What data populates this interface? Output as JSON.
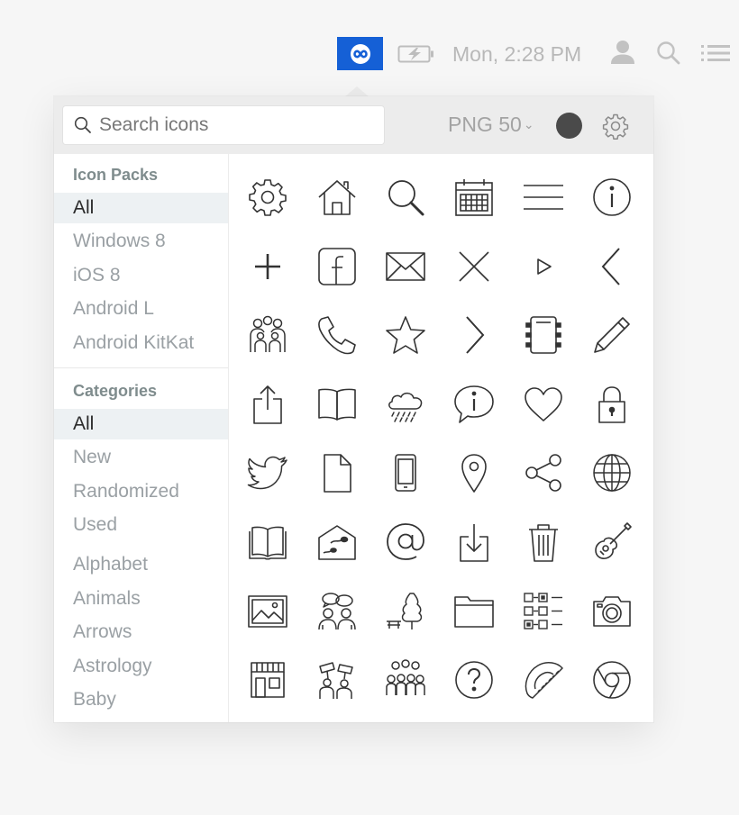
{
  "menubar": {
    "time": "Mon, 2:28 PM",
    "app_color": "#1560d6",
    "icons": [
      "infinity-icon",
      "battery-charging-icon",
      "user-icon",
      "search-icon",
      "list-icon"
    ]
  },
  "toolbar": {
    "search_placeholder": "Search icons",
    "format_label": "PNG 50",
    "color_value": "#4a4a4a"
  },
  "sidebar": {
    "packs_heading": "Icon Packs",
    "packs": [
      {
        "label": "All",
        "active": true
      },
      {
        "label": "Windows 8"
      },
      {
        "label": "iOS 8"
      },
      {
        "label": "Android L"
      },
      {
        "label": "Android KitKat"
      }
    ],
    "categories_heading": "Categories",
    "categories": [
      {
        "label": "All",
        "active": true
      },
      {
        "label": "New"
      },
      {
        "label": "Randomized"
      },
      {
        "label": "Used"
      },
      {
        "label": "Alphabet"
      },
      {
        "label": "Animals"
      },
      {
        "label": "Arrows"
      },
      {
        "label": "Astrology"
      },
      {
        "label": "Baby"
      }
    ]
  },
  "grid": {
    "icons": [
      "gear-icon",
      "home-icon",
      "search-icon",
      "calendar-icon",
      "menu-lines-icon",
      "info-circle-icon",
      "plus-icon",
      "facebook-icon",
      "mail-icon",
      "close-x-icon",
      "play-triangle-icon",
      "chevron-left-icon",
      "group-icon",
      "phone-icon",
      "star-icon",
      "chevron-right-icon",
      "processor-chip-icon",
      "pencil-icon",
      "share-upload-icon",
      "open-book-icon",
      "rain-cloud-icon",
      "info-bubble-icon",
      "heart-icon",
      "lock-icon",
      "twitter-bird-icon",
      "document-icon",
      "smartphone-icon",
      "map-pin-icon",
      "share-nodes-icon",
      "globe-icon",
      "book-icon",
      "sperm-house-icon",
      "at-sign-icon",
      "download-tray-icon",
      "trash-icon",
      "guitar-icon",
      "picture-icon",
      "discussion-icon",
      "park-tree-icon",
      "folder-icon",
      "checklist-icon",
      "camera-icon",
      "shop-icon",
      "protest-icon",
      "crowd-icon",
      "help-circle-icon",
      "protractor-icon",
      "chrome-icon"
    ]
  }
}
